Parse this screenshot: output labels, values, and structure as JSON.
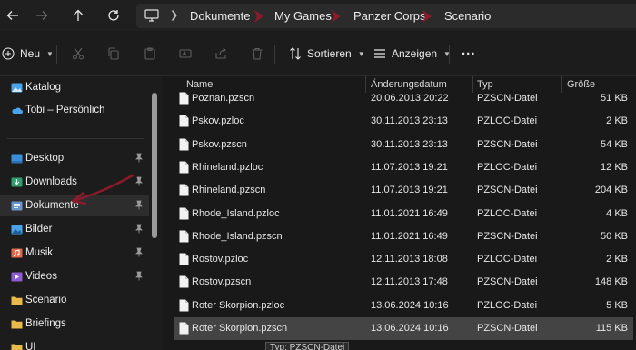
{
  "breadcrumb": [
    "Dokumente",
    "My Games",
    "Panzer Corps",
    "Scenario"
  ],
  "toolbar": {
    "new_label": "Neu",
    "sort_label": "Sortieren",
    "view_label": "Anzeigen",
    "more_label": "..."
  },
  "sidebar": {
    "items": [
      {
        "label": "Katalog",
        "icon": "gallery-icon"
      },
      {
        "label": "Tobi – Persönlich",
        "icon": "onedrive-icon"
      },
      {
        "label": "Desktop",
        "icon": "desktop-folder-icon",
        "pinned": true
      },
      {
        "label": "Downloads",
        "icon": "downloads-folder-icon",
        "pinned": true
      },
      {
        "label": "Dokumente",
        "icon": "documents-folder-icon",
        "pinned": true,
        "selected": true
      },
      {
        "label": "Bilder",
        "icon": "pictures-folder-icon",
        "pinned": true
      },
      {
        "label": "Musik",
        "icon": "music-folder-icon",
        "pinned": true
      },
      {
        "label": "Videos",
        "icon": "videos-folder-icon",
        "pinned": true
      },
      {
        "label": "Scenario",
        "icon": "folder-icon"
      },
      {
        "label": "Briefings",
        "icon": "folder-icon"
      },
      {
        "label": "UI",
        "icon": "folder-icon"
      }
    ]
  },
  "columns": {
    "name": "Name",
    "date": "Änderungsdatum",
    "type": "Typ",
    "size": "Größe"
  },
  "files": [
    {
      "name": "Poznan.pzscn",
      "date": "20.06.2013 20:22",
      "type": "PZSCN-Datei",
      "size": "51 KB"
    },
    {
      "name": "Pskov.pzloc",
      "date": "30.11.2013 23:13",
      "type": "PZLOC-Datei",
      "size": "2 KB"
    },
    {
      "name": "Pskov.pzscn",
      "date": "30.11.2013 23:13",
      "type": "PZSCN-Datei",
      "size": "54 KB"
    },
    {
      "name": "Rhineland.pzloc",
      "date": "11.07.2013 19:21",
      "type": "PZLOC-Datei",
      "size": "12 KB"
    },
    {
      "name": "Rhineland.pzscn",
      "date": "11.07.2013 19:21",
      "type": "PZSCN-Datei",
      "size": "204 KB"
    },
    {
      "name": "Rhode_Island.pzloc",
      "date": "11.01.2021 16:49",
      "type": "PZLOC-Datei",
      "size": "4 KB"
    },
    {
      "name": "Rhode_Island.pzscn",
      "date": "11.01.2021 16:49",
      "type": "PZSCN-Datei",
      "size": "50 KB"
    },
    {
      "name": "Rostov.pzloc",
      "date": "12.11.2013 18:08",
      "type": "PZLOC-Datei",
      "size": "2 KB"
    },
    {
      "name": "Rostov.pzscn",
      "date": "12.11.2013 17:48",
      "type": "PZSCN-Datei",
      "size": "148 KB"
    },
    {
      "name": "Roter Skorpion.pzloc",
      "date": "13.06.2024 10:16",
      "type": "PZLOC-Datei",
      "size": "5 KB"
    },
    {
      "name": "Roter Skorpion.pzscn",
      "date": "13.06.2024 10:16",
      "type": "PZSCN-Datei",
      "size": "115 KB",
      "selected": true
    }
  ],
  "tooltip": "Typ: PZSCN-Datei",
  "colors": {
    "annotation_red": "#8b1a2b",
    "accent_blue": "#4aa3e8",
    "folder_yellow": "#e9b949"
  }
}
